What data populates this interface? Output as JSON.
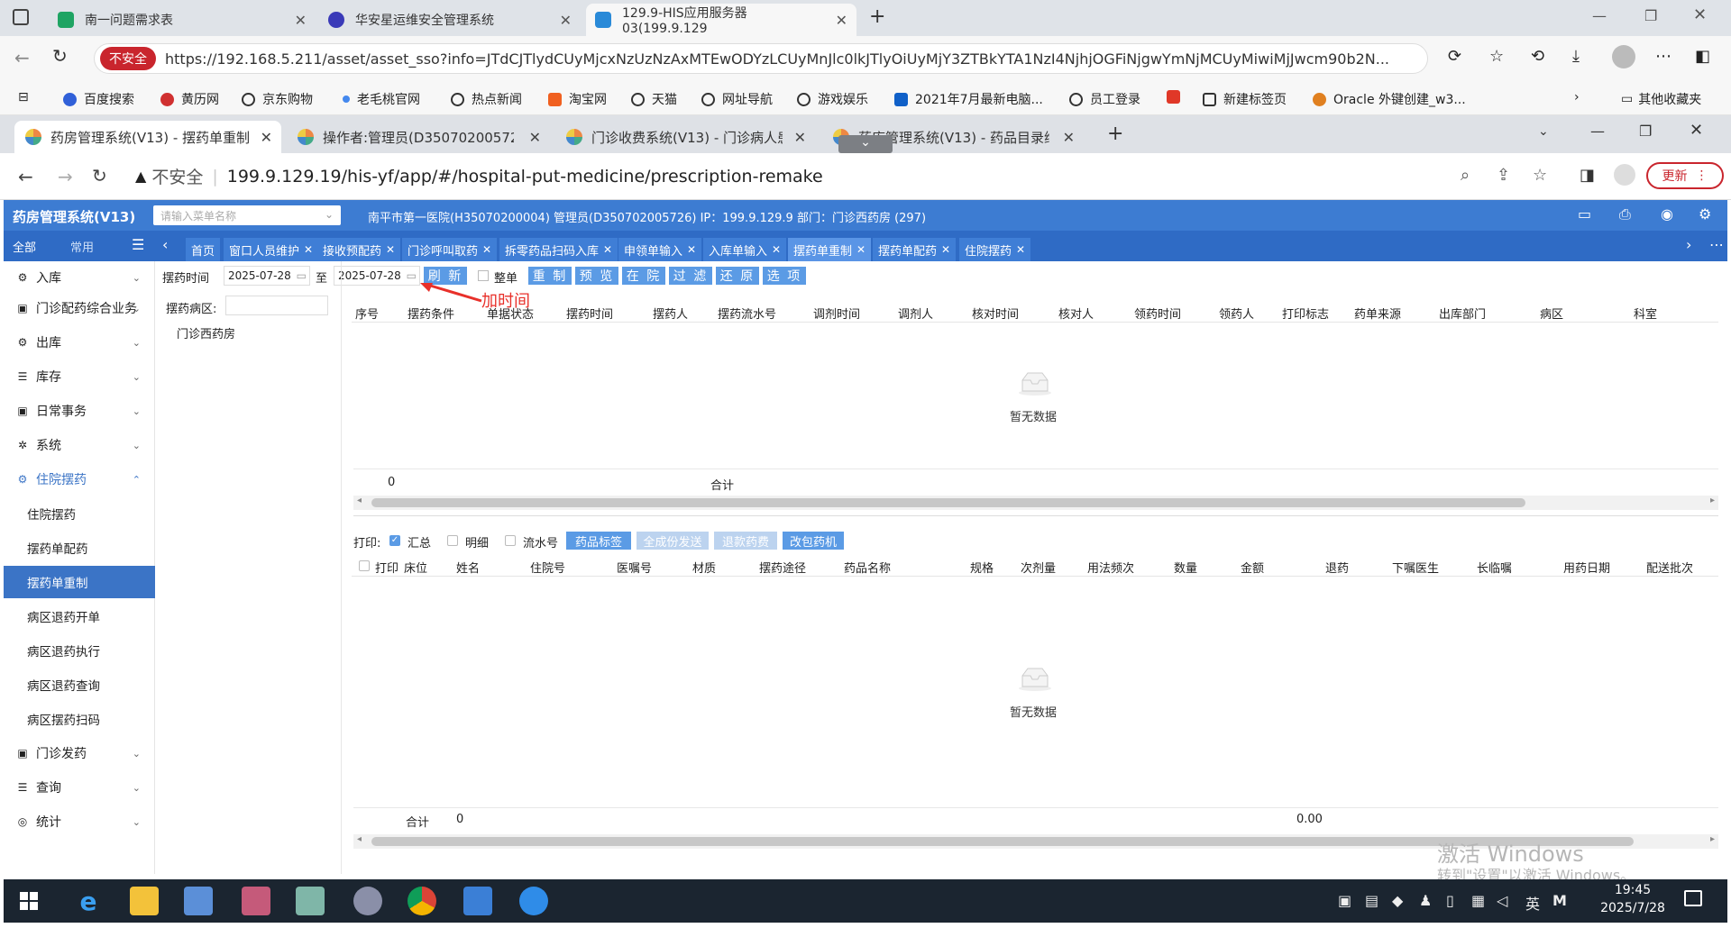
{
  "edge": {
    "tabs": [
      {
        "label": "南一问题需求表"
      },
      {
        "label": "华安星运维安全管理系统"
      },
      {
        "label": "129.9-HIS应用服务器03(199.9.129"
      }
    ],
    "insecure": "不安全",
    "url": "https://192.168.5.211/asset/asset_sso?info=JTdCJTlydCUyMjcxNzUzNzAxMTEwODYzLCUyMnJlc0lkJTlyOiUyMjY3ZTBkYTA1NzI4NjhjOGFiNjgwYmNjMCUyMiwiMjJwcm90b2N...",
    "favorites": [
      "百度搜索",
      "黄历网",
      "京东购物",
      "老毛桃官网",
      "热点新闻",
      "淘宝网",
      "天猫",
      "网址导航",
      "游戏娱乐",
      "2021年7月最新电脑...",
      "员工登录",
      "新建标签页",
      "Oracle 外键创建_w3..."
    ],
    "other_favorites": "其他收藏夹"
  },
  "chrome": {
    "tabs": [
      {
        "label": "药房管理系统(V13) - 摆药单重制"
      },
      {
        "label": "操作者:管理员(D350702005726"
      },
      {
        "label": "门诊收费系统(V13) - 门诊病人患"
      },
      {
        "label": "药库管理系统(V13) - 药品目录维"
      }
    ],
    "insecure": "不安全",
    "url": "199.9.129.19/his-yf/app/#/hospital-put-medicine/prescription-remake",
    "update": "更新"
  },
  "app": {
    "title": "药房管理系统(V13)",
    "menu_search_placeholder": "请输入菜单名称",
    "info": "南平市第一医院(H35070200004) 管理员(D350702005726) IP：199.9.129.9 部门：门诊西药房 (297)",
    "side_tabs": [
      "全部",
      "常用"
    ],
    "nav_tabs": [
      "首页",
      "窗口人员维护",
      "接收预配药",
      "门诊呼叫取药",
      "拆零药品扫码入库",
      "申领单输入",
      "入库单输入",
      "摆药单重制",
      "摆药单配药",
      "住院摆药"
    ],
    "sidebar": [
      {
        "label": "入库",
        "icon": "⚙"
      },
      {
        "label": "门诊配药综合业务",
        "icon": "▣"
      },
      {
        "label": "出库",
        "icon": "⚙"
      },
      {
        "label": "库存",
        "icon": "☰"
      },
      {
        "label": "日常事务",
        "icon": "▣"
      },
      {
        "label": "系统",
        "icon": "✲"
      },
      {
        "label": "住院摆药",
        "icon": "⚙"
      },
      {
        "label": "住院摆药",
        "sub": true
      },
      {
        "label": "摆药单配药",
        "sub": true
      },
      {
        "label": "摆药单重制",
        "sub": true
      },
      {
        "label": "病区退药开单",
        "sub": true
      },
      {
        "label": "病区退药执行",
        "sub": true
      },
      {
        "label": "病区退药查询",
        "sub": true
      },
      {
        "label": "病区摆药扫码",
        "sub": true
      },
      {
        "label": "门诊发药",
        "icon": "▣"
      },
      {
        "label": "查询",
        "icon": "☰"
      },
      {
        "label": "统计",
        "icon": "◎"
      }
    ],
    "filter": {
      "time_label": "摆药时间",
      "date_from": "2025-07-28",
      "to": "至",
      "date_to": "2025-07-28",
      "refresh": "刷 新",
      "whole": "整单",
      "buttons": [
        "重 制",
        "预 览",
        "在 院",
        "过 滤",
        "还 原",
        "选 项"
      ]
    },
    "annotation": "加时间",
    "ward_label": "摆药病区:",
    "ward_item": "门诊西药房",
    "top_headers": [
      "序号",
      "摆药条件",
      "单据状态",
      "摆药时间",
      "摆药人",
      "摆药流水号",
      "调剂时间",
      "调剂人",
      "核对时间",
      "核对人",
      "领药时间",
      "领药人",
      "打印标志",
      "药单来源",
      "出库部门",
      "病区",
      "科室"
    ],
    "empty": "暂无数据",
    "top_footer": {
      "count": "0",
      "total_label": "合计"
    },
    "print_label": "打印:",
    "print_opts": [
      "汇总",
      "明细",
      "流水号"
    ],
    "print_buttons": [
      "药品标签",
      "全成份发送",
      "退款药费",
      "改包药机"
    ],
    "bottom_headers": [
      "打印",
      "床位",
      "姓名",
      "住院号",
      "医嘱号",
      "材质",
      "摆药途径",
      "药品名称",
      "规格",
      "次剂量",
      "用法频次",
      "数量",
      "金额",
      "退药",
      "下嘱医生",
      "长临嘱",
      "用药日期",
      "配送批次"
    ],
    "bottom_footer": {
      "total_label": "合计",
      "count": "0",
      "amount": "0.00"
    }
  },
  "activation": {
    "line1": "激活 Windows",
    "line2": "转到\"设置\"以激活 Windows。"
  },
  "taskbar": {
    "time": "19:45",
    "date": "2025/7/28",
    "ime": "英"
  }
}
